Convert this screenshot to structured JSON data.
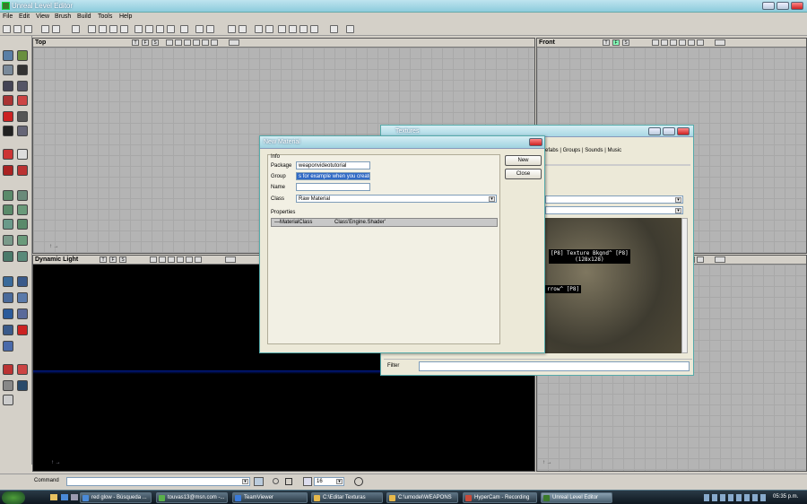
{
  "window": {
    "title": "Unreal Level Editor"
  },
  "menu": [
    "File",
    "Edit",
    "View",
    "Brush",
    "Build",
    "Tools",
    "Help"
  ],
  "viewports": {
    "top": {
      "label": "Top"
    },
    "front": {
      "label": "Front"
    },
    "dynamic": {
      "label": "Dynamic Light"
    },
    "btn_t": "T",
    "btn_f": "F",
    "btn_s": "S"
  },
  "textures_window": {
    "title": "Textures",
    "tabs": [
      "efabs",
      "Groups",
      "Sounds",
      "Music"
    ],
    "items": [
      {
        "label": "[P8] Texture Bkgnd^ [P8]",
        "size": "(128x128)"
      },
      {
        "label": "rrow^ [P8]"
      }
    ],
    "filter_label": "Filter"
  },
  "new_material": {
    "title": "New Material",
    "info_label": "Info",
    "package_label": "Package",
    "package_value": "weaponvideotutorial",
    "group_label": "Group",
    "group_value": "s for example when you create",
    "name_label": "Name",
    "name_value": "",
    "class_label": "Class",
    "class_value": "Raw Material",
    "properties_label": "Properties",
    "prop_key": "—MaterialClass",
    "prop_value": "Class'Engine.Shader'",
    "new_button": "New",
    "close_button": "Close"
  },
  "command_bar": {
    "label": "Command",
    "grid_value": "16"
  },
  "taskbar": {
    "items": [
      "red glow - Búsqueda ...",
      "touvas13@msn.com -...",
      "TeamViewer",
      "C:\\Editar Texturas",
      "C:\\umodel\\WEAPONS",
      "HyperCam - Recording",
      "Unreal Level Editor"
    ],
    "clock": "05:35 p.m."
  }
}
